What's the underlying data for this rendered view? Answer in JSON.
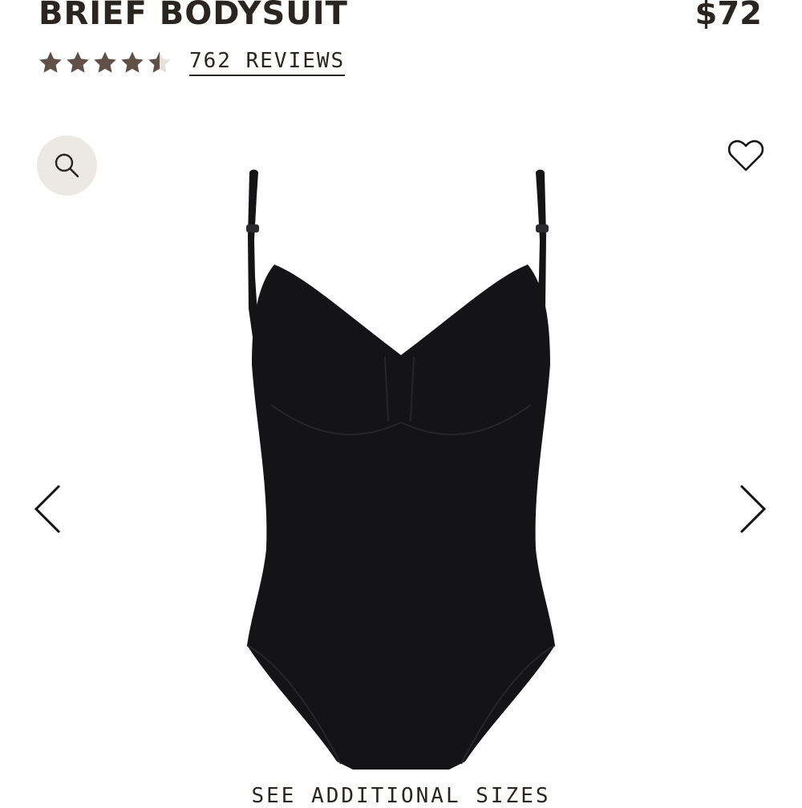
{
  "product": {
    "title": "BRIEF BODYSUIT",
    "price": "$72",
    "color": "#141416"
  },
  "rating": {
    "value": 4.5,
    "max": 5,
    "star_color": "#5f5148",
    "reviews_label": "762 REVIEWS"
  },
  "gallery": {
    "zoom_icon": "search-icon",
    "favorite_icon": "heart-outline-icon",
    "prev_icon": "chevron-left-icon",
    "next_icon": "chevron-right-icon",
    "zoom_bg": "#ece9e5"
  },
  "sizes_link": "SEE ADDITIONAL SIZES"
}
